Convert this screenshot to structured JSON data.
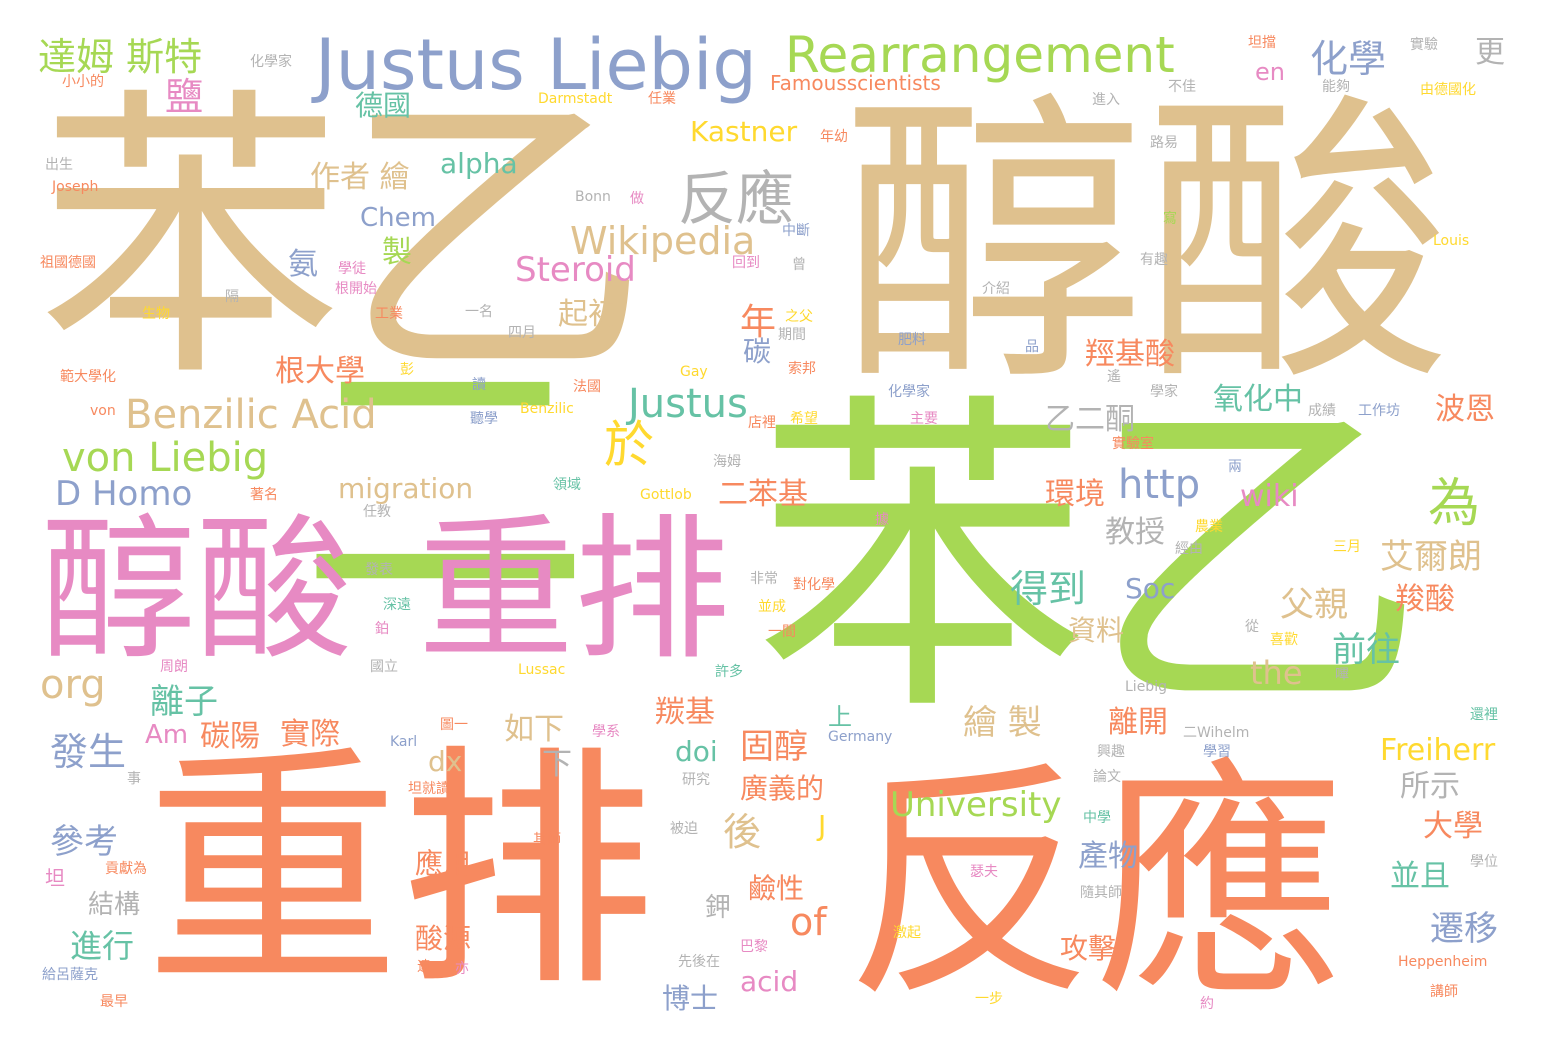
{
  "wordcloud": {
    "colors": {
      "tan": "#dfc18e",
      "orange": "#f7895f",
      "green": "#a6d854",
      "pink": "#e78ac3",
      "blue": "#8da0cb",
      "teal": "#66c2a5",
      "yellow": "#ffd92f",
      "gray": "#b3b3b3"
    },
    "words": [
      {
        "text": "苯乙",
        "color": "tan"
      },
      {
        "text": "醇酸",
        "color": "tan"
      },
      {
        "text": "苯乙",
        "color": "green"
      },
      {
        "text": "二",
        "color": "green"
      },
      {
        "text": "醇酸",
        "color": "pink"
      },
      {
        "text": "重排",
        "color": "pink"
      },
      {
        "text": "重排",
        "color": "orange"
      },
      {
        "text": "反應",
        "color": "orange"
      },
      {
        "text": "Justus Liebig",
        "color": "blue"
      },
      {
        "text": "Rearrangement",
        "color": "green"
      },
      {
        "text": "達姆 斯特",
        "color": "green"
      },
      {
        "text": "化學",
        "color": "blue"
      },
      {
        "text": "更",
        "color": "gray"
      },
      {
        "text": "反應",
        "color": "gray"
      },
      {
        "text": "Wikipedia",
        "color": "tan"
      },
      {
        "text": "Steroid",
        "color": "pink"
      },
      {
        "text": "Benzilic Acid",
        "color": "tan"
      },
      {
        "text": "Justus",
        "color": "teal"
      },
      {
        "text": "von Liebig",
        "color": "green"
      },
      {
        "text": "D Homo",
        "color": "blue"
      },
      {
        "text": "org",
        "color": "tan"
      },
      {
        "text": "http",
        "color": "blue"
      },
      {
        "text": "於",
        "color": "yellow"
      },
      {
        "text": "為",
        "color": "green"
      },
      {
        "text": "作者 繪",
        "color": "tan"
      },
      {
        "text": "alpha",
        "color": "teal"
      },
      {
        "text": "Chem",
        "color": "blue"
      },
      {
        "text": "Kastner",
        "color": "yellow"
      },
      {
        "text": "德國",
        "color": "teal"
      },
      {
        "text": "鹽",
        "color": "pink"
      },
      {
        "text": "en",
        "color": "pink"
      },
      {
        "text": "Famousscientists",
        "color": "orange"
      },
      {
        "text": "氧化中",
        "color": "teal"
      },
      {
        "text": "羥基酸",
        "color": "orange"
      },
      {
        "text": "乙二酮",
        "color": "gray"
      },
      {
        "text": "波恩",
        "color": "orange"
      },
      {
        "text": "migration",
        "color": "tan"
      },
      {
        "text": "二苯基",
        "color": "orange"
      },
      {
        "text": "環境",
        "color": "orange"
      },
      {
        "text": "wiki",
        "color": "pink"
      },
      {
        "text": "教授",
        "color": "gray"
      },
      {
        "text": "艾爾朗",
        "color": "tan"
      },
      {
        "text": "羧酸",
        "color": "orange"
      },
      {
        "text": "得到",
        "color": "teal"
      },
      {
        "text": "Soc",
        "color": "blue"
      },
      {
        "text": "父親",
        "color": "tan"
      },
      {
        "text": "資料",
        "color": "tan"
      },
      {
        "text": "前往",
        "color": "teal"
      },
      {
        "text": "the",
        "color": "tan"
      },
      {
        "text": "年",
        "color": "orange"
      },
      {
        "text": "起初",
        "color": "tan"
      },
      {
        "text": "製",
        "color": "green"
      },
      {
        "text": "氨",
        "color": "blue"
      },
      {
        "text": "碳",
        "color": "blue"
      },
      {
        "text": "根大學",
        "color": "orange"
      },
      {
        "text": "離子",
        "color": "teal"
      },
      {
        "text": "發生",
        "color": "blue"
      },
      {
        "text": "Am",
        "color": "pink"
      },
      {
        "text": "碳陽",
        "color": "orange"
      },
      {
        "text": "實際",
        "color": "orange"
      },
      {
        "text": "如下",
        "color": "tan"
      },
      {
        "text": "羰基",
        "color": "orange"
      },
      {
        "text": "上",
        "color": "teal"
      },
      {
        "text": "固醇",
        "color": "orange"
      },
      {
        "text": "繪 製",
        "color": "tan"
      },
      {
        "text": "離開",
        "color": "orange"
      },
      {
        "text": "Freiherr",
        "color": "yellow"
      },
      {
        "text": "doi",
        "color": "teal"
      },
      {
        "text": "dx",
        "color": "tan"
      },
      {
        "text": "下",
        "color": "gray"
      },
      {
        "text": "廣義的",
        "color": "orange"
      },
      {
        "text": "University",
        "color": "green"
      },
      {
        "text": "所示",
        "color": "gray"
      },
      {
        "text": "後",
        "color": "tan"
      },
      {
        "text": "J",
        "color": "yellow"
      },
      {
        "text": "大學",
        "color": "orange"
      },
      {
        "text": "參考",
        "color": "blue"
      },
      {
        "text": "應用",
        "color": "orange"
      },
      {
        "text": "of",
        "color": "orange"
      },
      {
        "text": "產物",
        "color": "blue"
      },
      {
        "text": "並且",
        "color": "teal"
      },
      {
        "text": "結構",
        "color": "gray"
      },
      {
        "text": "鹼性",
        "color": "orange"
      },
      {
        "text": "鉀",
        "color": "gray"
      },
      {
        "text": "遷移",
        "color": "blue"
      },
      {
        "text": "進行",
        "color": "teal"
      },
      {
        "text": "酸源",
        "color": "orange"
      },
      {
        "text": "攻擊",
        "color": "orange"
      },
      {
        "text": "博士",
        "color": "blue"
      },
      {
        "text": "acid",
        "color": "pink"
      },
      {
        "text": "坦",
        "color": "pink"
      },
      {
        "text": "化學家",
        "color": "gray"
      },
      {
        "text": "小小的",
        "color": "orange"
      },
      {
        "text": "Darmstadt",
        "color": "yellow"
      },
      {
        "text": "任業",
        "color": "orange"
      },
      {
        "text": "坦擋",
        "color": "orange"
      },
      {
        "text": "實驗",
        "color": "gray"
      },
      {
        "text": "能夠",
        "color": "gray"
      },
      {
        "text": "由德國化",
        "color": "yellow"
      },
      {
        "text": "進入",
        "color": "gray"
      },
      {
        "text": "不佳",
        "color": "gray"
      },
      {
        "text": "出生",
        "color": "gray"
      },
      {
        "text": "Joseph",
        "color": "orange"
      },
      {
        "text": "年幼",
        "color": "orange"
      },
      {
        "text": "路易",
        "color": "gray"
      },
      {
        "text": "Bonn",
        "color": "gray"
      },
      {
        "text": "做",
        "color": "pink"
      },
      {
        "text": "中斷",
        "color": "blue"
      },
      {
        "text": "寫",
        "color": "green"
      },
      {
        "text": "Louis",
        "color": "yellow"
      },
      {
        "text": "祖國德國",
        "color": "orange"
      },
      {
        "text": "學徒",
        "color": "pink"
      },
      {
        "text": "回到",
        "color": "pink"
      },
      {
        "text": "曾",
        "color": "gray"
      },
      {
        "text": "有趣",
        "color": "gray"
      },
      {
        "text": "根開始",
        "color": "pink"
      },
      {
        "text": "介紹",
        "color": "gray"
      },
      {
        "text": "隔",
        "color": "gray"
      },
      {
        "text": "生物",
        "color": "yellow"
      },
      {
        "text": "工業",
        "color": "orange"
      },
      {
        "text": "一名",
        "color": "gray"
      },
      {
        "text": "四月",
        "color": "gray"
      },
      {
        "text": "之父",
        "color": "yellow"
      },
      {
        "text": "期間",
        "color": "gray"
      },
      {
        "text": "肥料",
        "color": "blue"
      },
      {
        "text": "品",
        "color": "blue"
      },
      {
        "text": "範大學化",
        "color": "orange"
      },
      {
        "text": "彭",
        "color": "yellow"
      },
      {
        "text": "Gay",
        "color": "yellow"
      },
      {
        "text": "索邦",
        "color": "orange"
      },
      {
        "text": "遙",
        "color": "gray"
      },
      {
        "text": "讀",
        "color": "blue"
      },
      {
        "text": "法國",
        "color": "orange"
      },
      {
        "text": "化學家",
        "color": "blue"
      },
      {
        "text": "學家",
        "color": "gray"
      },
      {
        "text": "von",
        "color": "orange"
      },
      {
        "text": "聽學",
        "color": "blue"
      },
      {
        "text": "Benzilic",
        "color": "yellow"
      },
      {
        "text": "店裡",
        "color": "orange"
      },
      {
        "text": "希望",
        "color": "yellow"
      },
      {
        "text": "主要",
        "color": "pink"
      },
      {
        "text": "成績",
        "color": "gray"
      },
      {
        "text": "工作坊",
        "color": "blue"
      },
      {
        "text": "實驗室",
        "color": "orange"
      },
      {
        "text": "海姆",
        "color": "gray"
      },
      {
        "text": "兩",
        "color": "blue"
      },
      {
        "text": "著名",
        "color": "orange"
      },
      {
        "text": "領域",
        "color": "teal"
      },
      {
        "text": "Gottlob",
        "color": "yellow"
      },
      {
        "text": "任教",
        "color": "gray"
      },
      {
        "text": "據",
        "color": "pink"
      },
      {
        "text": "農業",
        "color": "yellow"
      },
      {
        "text": "經由",
        "color": "gray"
      },
      {
        "text": "三月",
        "color": "yellow"
      },
      {
        "text": "發表",
        "color": "gray"
      },
      {
        "text": "非常",
        "color": "gray"
      },
      {
        "text": "對化學",
        "color": "orange"
      },
      {
        "text": "深遠",
        "color": "teal"
      },
      {
        "text": "並成",
        "color": "yellow"
      },
      {
        "text": "鉑",
        "color": "pink"
      },
      {
        "text": "一間",
        "color": "orange"
      },
      {
        "text": "從",
        "color": "gray"
      },
      {
        "text": "喜歡",
        "color": "yellow"
      },
      {
        "text": "周朗",
        "color": "pink"
      },
      {
        "text": "國立",
        "color": "gray"
      },
      {
        "text": "Lussac",
        "color": "yellow"
      },
      {
        "text": "許多",
        "color": "teal"
      },
      {
        "text": "Liebig",
        "color": "gray"
      },
      {
        "text": "嗶",
        "color": "gray"
      },
      {
        "text": "圖一",
        "color": "orange"
      },
      {
        "text": "二Wihelm",
        "color": "gray"
      },
      {
        "text": "還裡",
        "color": "teal"
      },
      {
        "text": "學系",
        "color": "pink"
      },
      {
        "text": "Germany",
        "color": "blue"
      },
      {
        "text": "興趣",
        "color": "gray"
      },
      {
        "text": "學習",
        "color": "blue"
      },
      {
        "text": "Karl",
        "color": "blue"
      },
      {
        "text": "研究",
        "color": "gray"
      },
      {
        "text": "論文",
        "color": "gray"
      },
      {
        "text": "事",
        "color": "gray"
      },
      {
        "text": "坦就讀",
        "color": "orange"
      },
      {
        "text": "中學",
        "color": "teal"
      },
      {
        "text": "被迫",
        "color": "gray"
      },
      {
        "text": "其師",
        "color": "orange"
      },
      {
        "text": "學位",
        "color": "gray"
      },
      {
        "text": "貢獻為",
        "color": "orange"
      },
      {
        "text": "瑟夫",
        "color": "pink"
      },
      {
        "text": "隨其師",
        "color": "gray"
      },
      {
        "text": "給呂薩克",
        "color": "blue"
      },
      {
        "text": "遠",
        "color": "orange"
      },
      {
        "text": "亦",
        "color": "pink"
      },
      {
        "text": "先後在",
        "color": "gray"
      },
      {
        "text": "巴黎",
        "color": "pink"
      },
      {
        "text": "激起",
        "color": "yellow"
      },
      {
        "text": "Heppenheim",
        "color": "orange"
      },
      {
        "text": "最早",
        "color": "orange"
      },
      {
        "text": "一步",
        "color": "yellow"
      },
      {
        "text": "約",
        "color": "pink"
      },
      {
        "text": "講師",
        "color": "orange"
      }
    ]
  }
}
